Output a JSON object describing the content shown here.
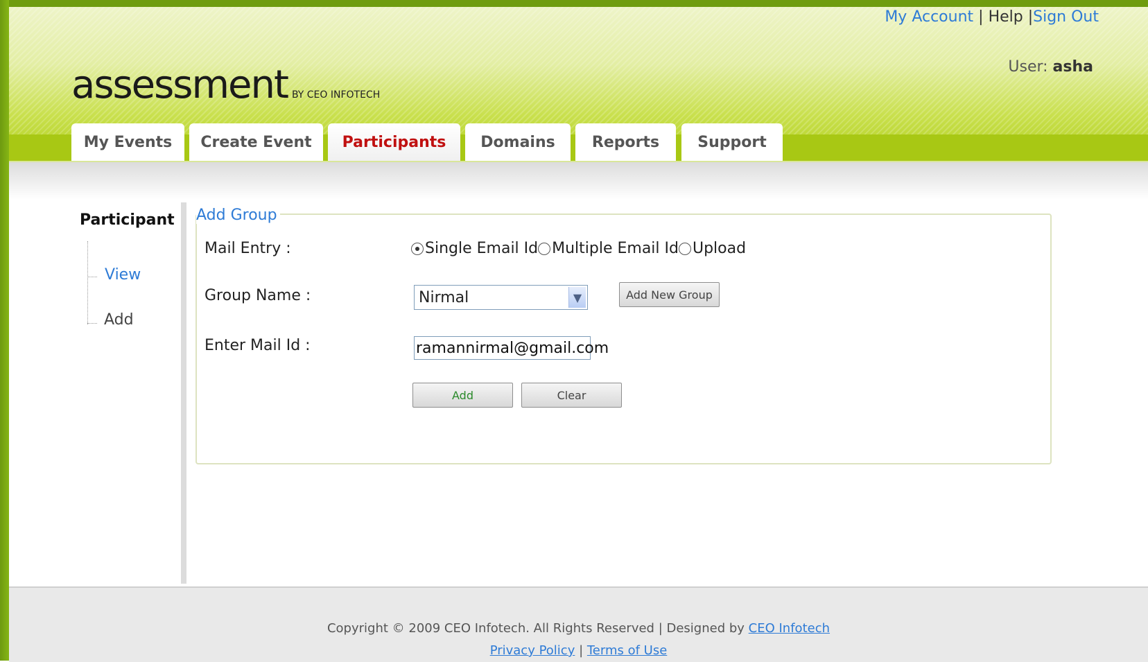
{
  "top_links": {
    "my_account": "My Account",
    "help": "Help",
    "sign_out": "Sign Out",
    "sep1": " | ",
    "sep2": " |"
  },
  "user": {
    "label": "User: ",
    "name": "asha"
  },
  "logo": {
    "main": "assessment",
    "byline": "BY CEO INFOTECH"
  },
  "tabs": [
    "My Events",
    "Create Event",
    "Participants",
    "Domains",
    "Reports",
    "Support"
  ],
  "active_tab": "Participants",
  "sidebar": {
    "title": "Participant",
    "items": [
      "View",
      "Add"
    ]
  },
  "form": {
    "legend": "Add Group",
    "mail_entry_label": "Mail Entry :",
    "mail_entry_options": [
      "Single Email Id",
      "Multiple Email Id",
      "Upload"
    ],
    "mail_entry_selected": "Single Email Id",
    "group_name_label": "Group Name :",
    "group_name_value": "Nirmal",
    "add_new_group_button": "Add New Group",
    "mail_id_label": "Enter Mail Id :",
    "mail_id_value": "ramannirmal@gmail.com",
    "add_button": "Add",
    "clear_button": "Clear"
  },
  "footer": {
    "copyright": "Copyright © 2009 CEO Infotech. All Rights Reserved | Designed by ",
    "designer_link": "CEO Infotech",
    "privacy": "Privacy Policy",
    "sep": " | ",
    "terms": "Terms of Use"
  },
  "colors": {
    "brand_green": "#a8c814",
    "link_blue": "#2e7bd6",
    "active_tab_red": "#c01010",
    "add_button_text": "#2a8a2a"
  }
}
